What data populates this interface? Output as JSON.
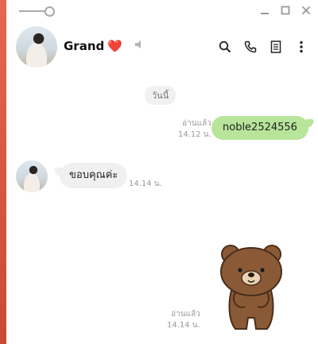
{
  "titlebar": {
    "controls": [
      "minimize-icon",
      "maximize-icon",
      "close-icon"
    ]
  },
  "header": {
    "contact_name": "Grand",
    "status_emoji": "❤️",
    "icons": [
      "speaker-icon",
      "search-icon",
      "phone-icon",
      "notes-icon",
      "more-icon"
    ]
  },
  "chat": {
    "date_label": "วันนี้",
    "messages": [
      {
        "direction": "out",
        "type": "text",
        "text": "noble2524556",
        "read": "อ่านแล้ว",
        "time": "14.12 น."
      },
      {
        "direction": "in",
        "type": "text",
        "text": "ขอบคุณค่ะ",
        "time": "14.14 น."
      },
      {
        "direction": "out",
        "type": "sticker",
        "sticker": "brown-bear-sticker",
        "read": "อ่านแล้ว",
        "time": "14.14 น."
      }
    ]
  },
  "colors": {
    "outgoing_bubble": "#b7e59a",
    "incoming_bubble": "#f0f0f0",
    "heart": "#e0242a",
    "edge": "#d9573f"
  }
}
